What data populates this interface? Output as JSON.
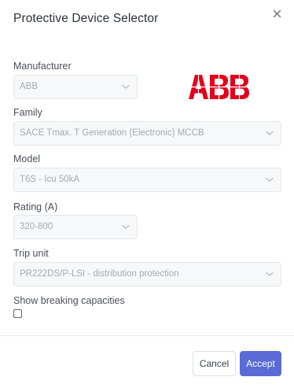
{
  "dialog": {
    "title": "Protective Device Selector"
  },
  "fields": {
    "manufacturer": {
      "label": "Manufacturer",
      "value": "ABB"
    },
    "family": {
      "label": "Family",
      "value": "SACE Tmax. T Generation (Electronic) MCCB"
    },
    "model": {
      "label": "Model",
      "value": "T6S - Icu 50kA"
    },
    "rating": {
      "label": "Rating (A)",
      "value": "320-800"
    },
    "trip_unit": {
      "label": "Trip unit",
      "value": "PR222DS/P-LSI - distribution protection"
    }
  },
  "breaking": {
    "label": "Show breaking capacities",
    "checked": false
  },
  "logo": {
    "text": "ABB",
    "color": "#e2001a"
  },
  "footer": {
    "cancel_label": "Cancel",
    "accept_label": "Accept"
  },
  "colors": {
    "accent": "#5a6bd6",
    "logo_red": "#e2001a"
  },
  "icons": [
    "close-icon",
    "chevron-down-icon"
  ]
}
